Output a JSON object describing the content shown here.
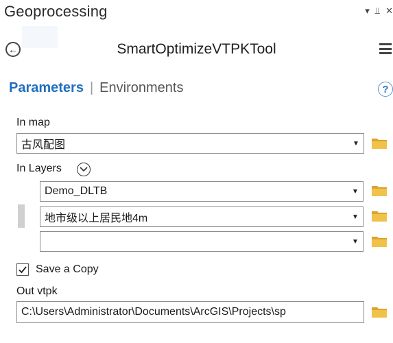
{
  "pane": {
    "title": "Geoprocessing",
    "controls": {
      "dropdown": "▾",
      "pin": "⫫",
      "close": "✕"
    }
  },
  "tool": {
    "back_glyph": "←",
    "title": "SmartOptimizeVTPKTool"
  },
  "tabs": {
    "parameters": "Parameters",
    "separator": "|",
    "environments": "Environments"
  },
  "help": {
    "glyph": "?"
  },
  "params": {
    "in_map": {
      "label": "In map",
      "value": "古风配图"
    },
    "in_layers": {
      "label": "In Layers",
      "rows": [
        {
          "value": "Demo_DLTB"
        },
        {
          "value": "地市级以上居民地4m"
        },
        {
          "value": ""
        }
      ]
    },
    "save_copy": {
      "label": "Save a Copy",
      "checked": true
    },
    "out_vtpk": {
      "label": "Out vtpk",
      "value": "C:\\Users\\Administrator\\Documents\\ArcGIS\\Projects\\sp"
    }
  },
  "colors": {
    "accent": "#1f6fbf",
    "folder_fill": "#f1c24a",
    "folder_dark": "#d9a52a"
  }
}
